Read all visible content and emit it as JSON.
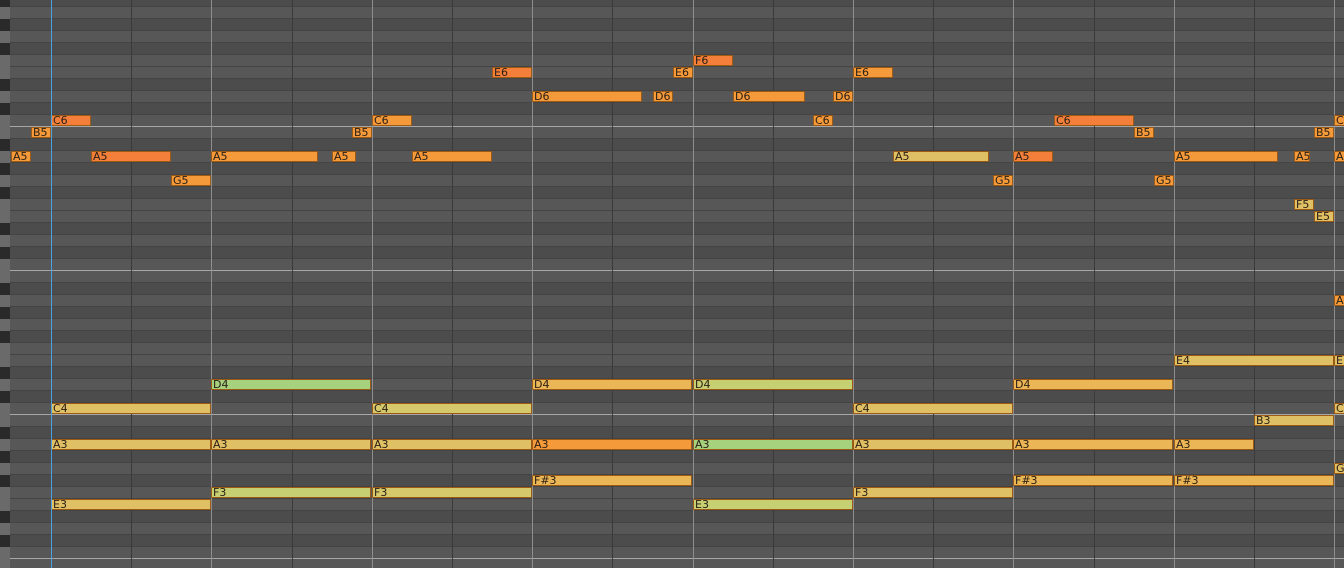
{
  "piano_roll": {
    "colors": {
      "background": "#4f4f4f",
      "white_lane": "#575757",
      "black_lane": "#4c4c4c",
      "octave_line": "#b9b9b9",
      "playhead": "#4aa3e0",
      "velocity_low": "#a6d27e",
      "velocity_mid": "#e0c065",
      "velocity_high": "#f59a3b",
      "velocity_max": "#f47f3a"
    },
    "notes": [
      {
        "label": "A5",
        "pitch": "A5",
        "start": -0.5,
        "length": 0.25,
        "color": "#f59a3b"
      },
      {
        "label": "B5",
        "pitch": "B5",
        "start": -0.25,
        "length": 0.25,
        "color": "#f59a3b"
      },
      {
        "label": "C6",
        "pitch": "C6",
        "start": 0,
        "length": 0.5,
        "color": "#f47f3a"
      },
      {
        "label": "A5",
        "pitch": "A5",
        "start": 0.5,
        "length": 1,
        "color": "#f47f3a"
      },
      {
        "label": "G5",
        "pitch": "G5",
        "start": 1.5,
        "length": 0.5,
        "color": "#f59a3b"
      },
      {
        "label": "A5",
        "pitch": "A5",
        "start": 2,
        "length": 1.33,
        "color": "#f59a3b"
      },
      {
        "label": "A5",
        "pitch": "A5",
        "start": 3.5,
        "length": 0.3,
        "color": "#f59a3b"
      },
      {
        "label": "B5",
        "pitch": "B5",
        "start": 3.75,
        "length": 0.25,
        "color": "#f59a3b"
      },
      {
        "label": "C6",
        "pitch": "C6",
        "start": 4,
        "length": 0.5,
        "color": "#f59a3b"
      },
      {
        "label": "A5",
        "pitch": "A5",
        "start": 4.5,
        "length": 1,
        "color": "#f59a3b"
      },
      {
        "label": "E6",
        "pitch": "E6",
        "start": 5.5,
        "length": 0.5,
        "color": "#f47f3a"
      },
      {
        "label": "D6",
        "pitch": "D6",
        "start": 6,
        "length": 1.37,
        "color": "#f59a3b"
      },
      {
        "label": "D6",
        "pitch": "D6",
        "start": 7.5,
        "length": 0.25,
        "color": "#f59a3b"
      },
      {
        "label": "E6",
        "pitch": "E6",
        "start": 7.75,
        "length": 0.25,
        "color": "#f59a3b"
      },
      {
        "label": "F6",
        "pitch": "F6",
        "start": 8,
        "length": 0.5,
        "color": "#f47f3a"
      },
      {
        "label": "D6",
        "pitch": "D6",
        "start": 8.5,
        "length": 0.9,
        "color": "#f59a3b"
      },
      {
        "label": "C6",
        "pitch": "C6",
        "start": 9.5,
        "length": 0.25,
        "color": "#f59a3b"
      },
      {
        "label": "D6",
        "pitch": "D6",
        "start": 9.75,
        "length": 0.25,
        "color": "#f59a3b"
      },
      {
        "label": "E6",
        "pitch": "E6",
        "start": 10,
        "length": 0.5,
        "color": "#f59a3b"
      },
      {
        "label": "A5",
        "pitch": "A5",
        "start": 10.5,
        "length": 1.2,
        "color": "#e0c065"
      },
      {
        "label": "G5",
        "pitch": "G5",
        "start": 11.75,
        "length": 0.25,
        "color": "#f59a3b"
      },
      {
        "label": "A5",
        "pitch": "A5",
        "start": 12,
        "length": 0.5,
        "color": "#f47f3a"
      },
      {
        "label": "C6",
        "pitch": "C6",
        "start": 12.5,
        "length": 1,
        "color": "#f47f3a"
      },
      {
        "label": "B5",
        "pitch": "B5",
        "start": 13.5,
        "length": 0.25,
        "color": "#f59a3b"
      },
      {
        "label": "G5",
        "pitch": "G5",
        "start": 13.75,
        "length": 0.25,
        "color": "#f59a3b"
      },
      {
        "label": "A5",
        "pitch": "A5",
        "start": 14,
        "length": 1.3,
        "color": "#f59a3b"
      },
      {
        "label": "A5",
        "pitch": "A5",
        "start": 15.5,
        "length": 0.2,
        "color": "#f59a3b"
      },
      {
        "label": "F5",
        "pitch": "F5",
        "start": 15.5,
        "length": 0.25,
        "color": "#e0c065"
      },
      {
        "label": "B5",
        "pitch": "B5",
        "start": 15.75,
        "length": 0.25,
        "color": "#f59a3b"
      },
      {
        "label": "E5",
        "pitch": "E5",
        "start": 15.75,
        "length": 0.25,
        "color": "#e0c065"
      },
      {
        "label": "C6",
        "pitch": "C6",
        "start": 16,
        "length": 0.5,
        "color": "#f59a3b"
      },
      {
        "label": "A5",
        "pitch": "A5",
        "start": 16,
        "length": 0.5,
        "color": "#f59a3b"
      },
      {
        "label": "C4",
        "pitch": "C4",
        "start": 0,
        "length": 2,
        "color": "#e0c065"
      },
      {
        "label": "A3",
        "pitch": "A3",
        "start": 0,
        "length": 2,
        "color": "#e0c065"
      },
      {
        "label": "E3",
        "pitch": "E3",
        "start": 0,
        "length": 2,
        "color": "#e0c065"
      },
      {
        "label": "D4",
        "pitch": "D4",
        "start": 2,
        "length": 2,
        "color": "#a6d27e"
      },
      {
        "label": "A3",
        "pitch": "A3",
        "start": 2,
        "length": 2,
        "color": "#e0c065"
      },
      {
        "label": "F3",
        "pitch": "F3",
        "start": 2,
        "length": 2,
        "color": "#c6cf72"
      },
      {
        "label": "C4",
        "pitch": "C4",
        "start": 4,
        "length": 2,
        "color": "#d6c96c"
      },
      {
        "label": "A3",
        "pitch": "A3",
        "start": 4,
        "length": 2,
        "color": "#e0c065"
      },
      {
        "label": "F3",
        "pitch": "F3",
        "start": 4,
        "length": 2,
        "color": "#d6c96c"
      },
      {
        "label": "D4",
        "pitch": "D4",
        "start": 6,
        "length": 2,
        "color": "#ebb655"
      },
      {
        "label": "A3",
        "pitch": "A3",
        "start": 6,
        "length": 2,
        "color": "#f59a3b"
      },
      {
        "label": "F#3",
        "pitch": "F#3",
        "start": 6,
        "length": 2,
        "color": "#ebb655"
      },
      {
        "label": "D4",
        "pitch": "D4",
        "start": 8,
        "length": 2,
        "color": "#c6cf72"
      },
      {
        "label": "A3",
        "pitch": "A3",
        "start": 8,
        "length": 2,
        "color": "#a6d27e"
      },
      {
        "label": "E3",
        "pitch": "E3",
        "start": 8,
        "length": 2,
        "color": "#c6cf72"
      },
      {
        "label": "C4",
        "pitch": "C4",
        "start": 10,
        "length": 2,
        "color": "#e0c065"
      },
      {
        "label": "A3",
        "pitch": "A3",
        "start": 10,
        "length": 2,
        "color": "#e0c065"
      },
      {
        "label": "F3",
        "pitch": "F3",
        "start": 10,
        "length": 2,
        "color": "#e0c065"
      },
      {
        "label": "D4",
        "pitch": "D4",
        "start": 12,
        "length": 2,
        "color": "#ebb655"
      },
      {
        "label": "A3",
        "pitch": "A3",
        "start": 12,
        "length": 2,
        "color": "#ebb655"
      },
      {
        "label": "F#3",
        "pitch": "F#3",
        "start": 12,
        "length": 2,
        "color": "#ebb655"
      },
      {
        "label": "E4",
        "pitch": "E4",
        "start": 14,
        "length": 2,
        "color": "#e0c065"
      },
      {
        "label": "A3",
        "pitch": "A3",
        "start": 14,
        "length": 1,
        "color": "#ebb655"
      },
      {
        "label": "F#3",
        "pitch": "F#3",
        "start": 14,
        "length": 2,
        "color": "#ebb655"
      },
      {
        "label": "B3",
        "pitch": "B3",
        "start": 15,
        "length": 1,
        "color": "#e0c065"
      },
      {
        "label": "A",
        "pitch": "A4",
        "start": 16,
        "length": 0.2,
        "color": "#f59a3b"
      },
      {
        "label": "E",
        "pitch": "E4",
        "start": 16,
        "length": 0.2,
        "color": "#e0c065"
      },
      {
        "label": "C",
        "pitch": "C4",
        "start": 16,
        "length": 0.2,
        "color": "#e0c065"
      },
      {
        "label": "G",
        "pitch": "G3",
        "start": 16,
        "length": 0.2,
        "color": "#e0c065"
      }
    ]
  }
}
